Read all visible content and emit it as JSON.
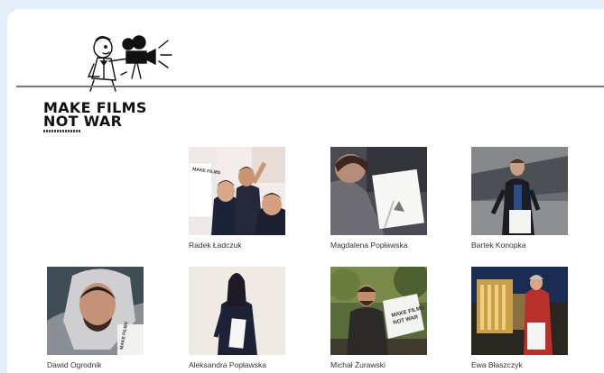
{
  "brand": {
    "line1": "MAKE FILMS",
    "line2": "NOT WAR"
  },
  "gallery": [
    {
      "name": "Radek Ładczuk"
    },
    {
      "name": "Magdalena Popławska"
    },
    {
      "name": "Bartek Konopka"
    },
    {
      "name": "Dawid Ogrodnik"
    },
    {
      "name": "Aleksandra Popławska"
    },
    {
      "name": "Michał Żurawski"
    },
    {
      "name": "Ewa Błaszczyk"
    }
  ]
}
